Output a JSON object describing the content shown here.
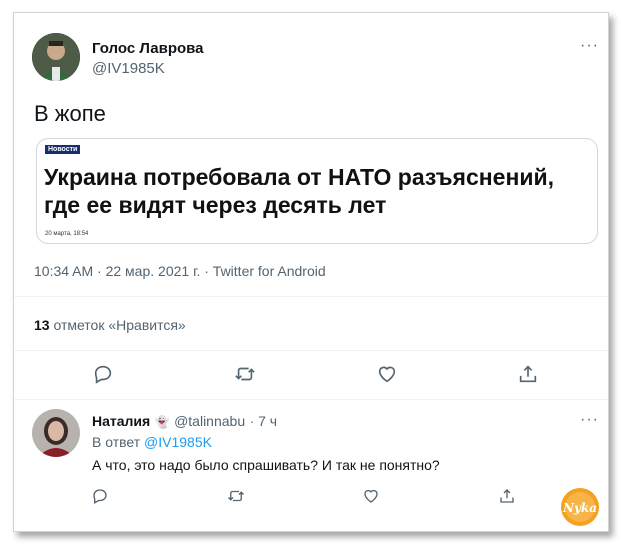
{
  "tweet": {
    "author_name": "Голос Лаврова",
    "author_handle": "@IV1985K",
    "more": "···",
    "text": "В жопе",
    "card": {
      "tag": "Новости",
      "headline_line1": "Украина потребовала от НАТО разъяснений,",
      "headline_line2": "где ее видят через десять лет",
      "date": "20 марта, 18:54"
    },
    "timestamp": "10:34 AM · 22 мар. 2021 г. · Twitter for Android",
    "likes_count": "13",
    "likes_label": "отметок «Нравится»"
  },
  "actions": {
    "icons": [
      "reply-icon",
      "retweet-icon",
      "like-icon",
      "share-icon"
    ]
  },
  "reply": {
    "name": "Наталия",
    "emoji": "👻",
    "handle": "@talinnabu",
    "time": "· 7 ч",
    "more": "···",
    "in_reply_prefix": "В ответ",
    "in_reply_handle": "@IV1985K",
    "text": "А что, это надо было спрашивать? И так не понятно?"
  },
  "watermark": {
    "text": "Nyka",
    "color": "#f4a020"
  }
}
